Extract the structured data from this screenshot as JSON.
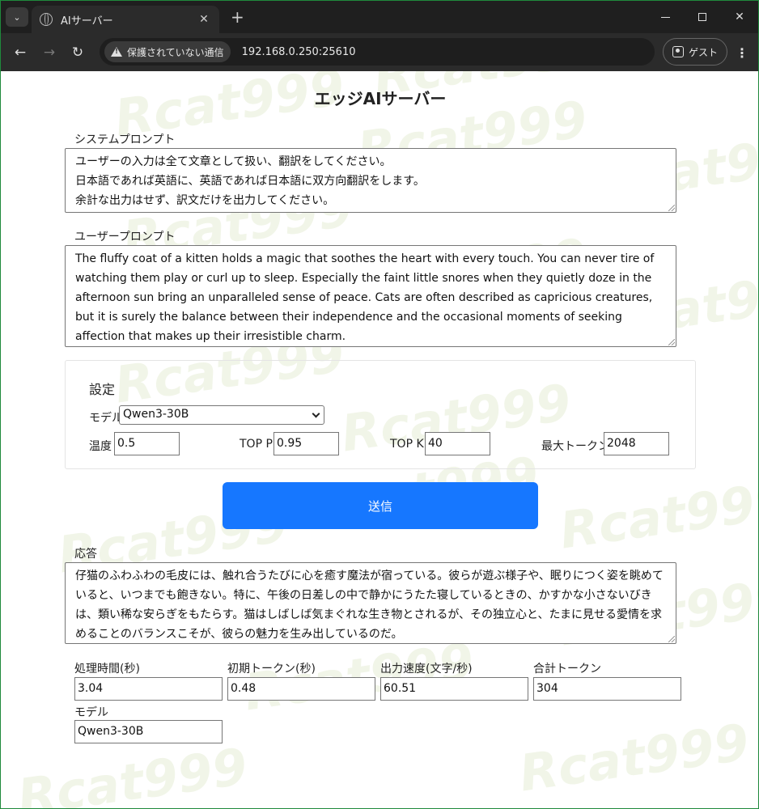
{
  "browser": {
    "tab_title": "AIサーバー",
    "security_label": "保護されていない通信",
    "url": "192.168.0.250:25610",
    "profile_label": "ゲスト"
  },
  "watermark": "Rcat999",
  "page": {
    "title": "エッジAIサーバー",
    "system_prompt_label": "システムプロンプト",
    "system_prompt_value": "ユーザーの入力は全て文章として扱い、翻訳をしてください。\n日本語であれば英語に、英語であれば日本語に双方向翻訳をします。\n余計な出力はせず、訳文だけを出力してください。",
    "user_prompt_label": "ユーザープロンプト",
    "user_prompt_value": "The fluffy coat of a kitten holds a magic that soothes the heart with every touch. You can never tire of watching them play or curl up to sleep. Especially the faint little snores when they quietly doze in the afternoon sun bring an unparalleled sense of peace. Cats are often described as capricious creatures, but it is surely the balance between their independence and the occasional moments of seeking affection that makes up their irresistible charm.",
    "settings": {
      "heading": "設定",
      "model_label": "モデル",
      "model_value": "Qwen3-30B",
      "temperature_label": "温度",
      "temperature_value": "0.5",
      "top_p_label": "TOP P",
      "top_p_value": "0.95",
      "top_k_label": "TOP K",
      "top_k_value": "40",
      "max_tokens_label": "最大トークン",
      "max_tokens_value": "2048"
    },
    "send_label": "送信",
    "response_label": "応答",
    "response_value": "仔猫のふわふわの毛皮には、触れ合うたびに心を癒す魔法が宿っている。彼らが遊ぶ様子や、眠りにつく姿を眺めていると、いつまでも飽きない。特に、午後の日差しの中で静かにうたた寝しているときの、かすかな小さないびきは、類い稀な安らぎをもたらす。猫はしばしば気まぐれな生き物とされるが、その独立心と、たまに見せる愛情を求めることのバランスこそが、彼らの魅力を生み出しているのだ。",
    "stats": {
      "processing_time_label": "処理時間(秒)",
      "processing_time_value": "3.04",
      "first_token_label": "初期トークン(秒)",
      "first_token_value": "0.48",
      "output_speed_label": "出力速度(文字/秒)",
      "output_speed_value": "60.51",
      "total_tokens_label": "合計トークン",
      "total_tokens_value": "304",
      "model_label": "モデル",
      "model_value": "Qwen3-30B"
    }
  }
}
